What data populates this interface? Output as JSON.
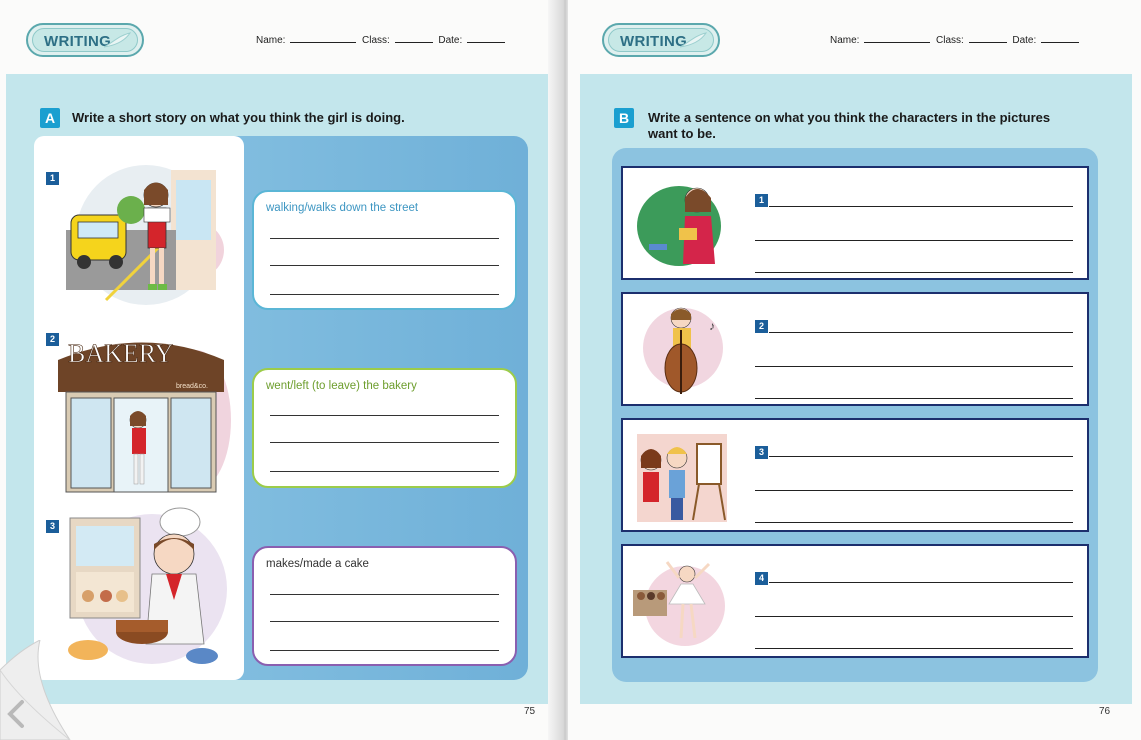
{
  "left_page": {
    "badge": "WRITING",
    "header": {
      "name_label": "Name:",
      "class_label": "Class:",
      "date_label": "Date:"
    },
    "section_letter": "A",
    "instruction": "Write a short story on what you think the girl is doing.",
    "items": [
      {
        "number": "1",
        "hint": "walking/walks down the street",
        "hint_color": "#3d96c2"
      },
      {
        "number": "2",
        "hint": "went/left (to leave) the bakery",
        "hint_color": "#6e9e2e",
        "sign": "BAKERY",
        "sub_sign": "bread&co."
      },
      {
        "number": "3",
        "hint": "makes/made a cake",
        "hint_color": "#333333"
      }
    ],
    "page_number": "75"
  },
  "right_page": {
    "badge": "WRITING",
    "header": {
      "name_label": "Name:",
      "class_label": "Class:",
      "date_label": "Date:"
    },
    "section_letter": "B",
    "instruction_line1": "Write a sentence on what you think the characters in the pictures",
    "instruction_line2": "want to be.",
    "items": [
      {
        "number": "1",
        "picture": "teacher"
      },
      {
        "number": "2",
        "picture": "cellist"
      },
      {
        "number": "3",
        "picture": "painter"
      },
      {
        "number": "4",
        "picture": "ballet-dancer"
      }
    ],
    "page_number": "76"
  },
  "colors": {
    "panel": "#c3e6ec",
    "badge_blue": "#1a9fd0",
    "box_border_1": "#5bb6d6",
    "box_border_2": "#9ccc4a",
    "box_border_3": "#8a5fb0",
    "row_border": "#1c2f6e"
  }
}
